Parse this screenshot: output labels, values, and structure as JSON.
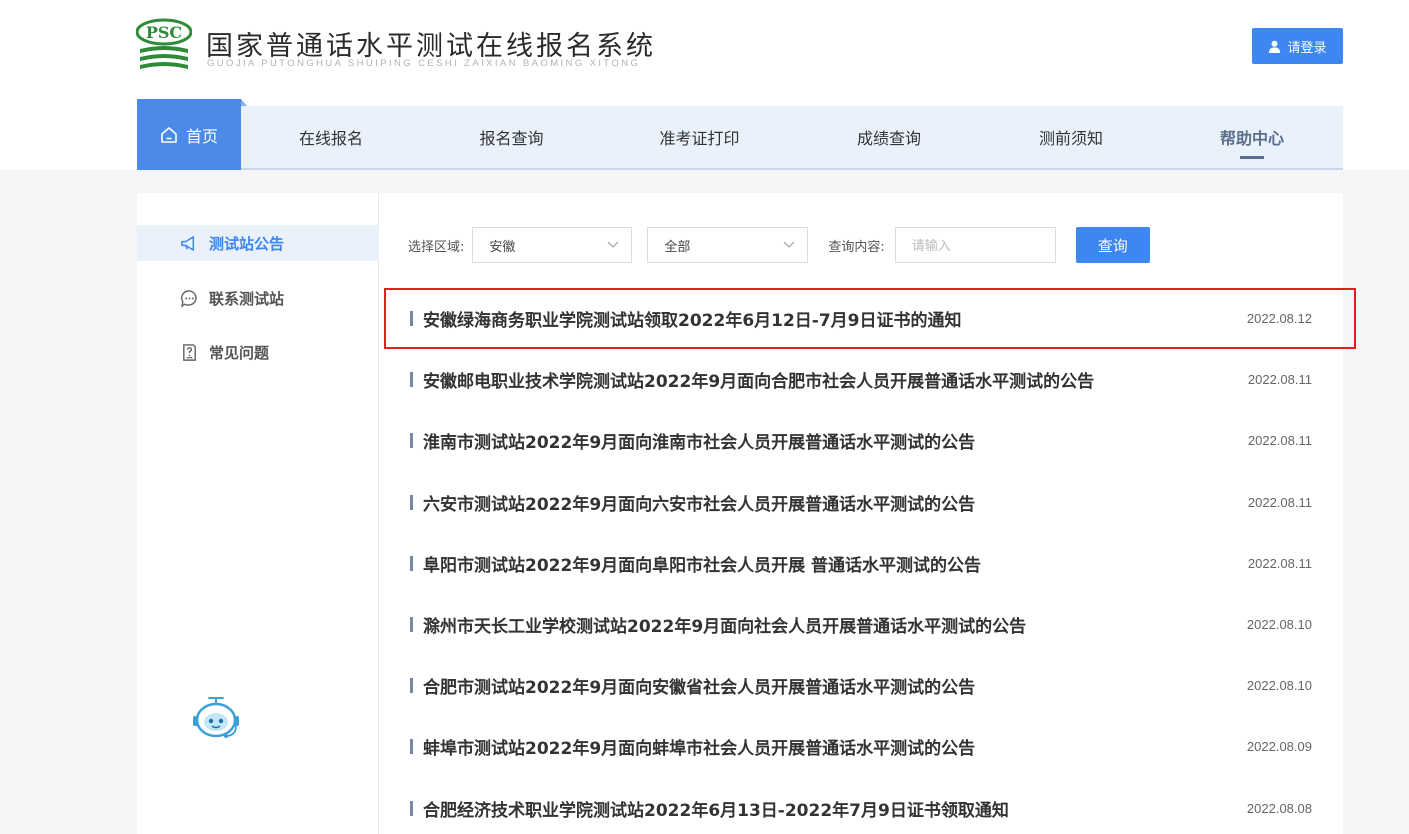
{
  "header": {
    "logo_text": "PSC",
    "title": "国家普通话水平测试在线报名系统",
    "subtitle": "GUOJIA PUTONGHUA SHUIPING CESHI ZAIXIAN BAOMING XITONG",
    "login_label": "请登录"
  },
  "nav": {
    "home_label": "首页",
    "items": [
      {
        "label": "在线报名"
      },
      {
        "label": "报名查询"
      },
      {
        "label": "准考证打印"
      },
      {
        "label": "成绩查询"
      },
      {
        "label": "测前须知"
      },
      {
        "label": "帮助中心",
        "active": true
      }
    ]
  },
  "sidebar": {
    "items": [
      {
        "label": "测试站公告",
        "icon": "megaphone-icon",
        "active": true
      },
      {
        "label": "联系测试站",
        "icon": "chat-icon"
      },
      {
        "label": "常见问题",
        "icon": "document-question-icon"
      }
    ],
    "assistant_icon": "robot-assistant-icon"
  },
  "filters": {
    "region_label": "选择区域:",
    "region_value": "安徽",
    "city_value": "全部",
    "query_label": "查询内容:",
    "query_placeholder": "请输入",
    "query_button": "查询"
  },
  "notices": [
    {
      "title": "安徽绿海商务职业学院测试站领取2022年6月12日-7月9日证书的通知",
      "date": "2022.08.12"
    },
    {
      "title": "安徽邮电职业技术学院测试站2022年9月面向合肥市社会人员开展普通话水平测试的公告",
      "date": "2022.08.11"
    },
    {
      "title": "淮南市测试站2022年9月面向淮南市社会人员开展普通话水平测试的公告",
      "date": "2022.08.11"
    },
    {
      "title": "六安市测试站2022年9月面向六安市社会人员开展普通话水平测试的公告",
      "date": "2022.08.11"
    },
    {
      "title": "阜阳市测试站2022年9月面向阜阳市社会人员开展 普通话水平测试的公告",
      "date": "2022.08.11"
    },
    {
      "title": "滁州市天长工业学校测试站2022年9月面向社会人员开展普通话水平测试的公告",
      "date": "2022.08.10"
    },
    {
      "title": "合肥市测试站2022年9月面向安徽省社会人员开展普通话水平测试的公告",
      "date": "2022.08.10"
    },
    {
      "title": "蚌埠市测试站2022年9月面向蚌埠市社会人员开展普通话水平测试的公告",
      "date": "2022.08.09"
    },
    {
      "title": "合肥经济技术职业学院测试站2022年6月13日-2022年7月9日证书领取通知",
      "date": "2022.08.08"
    }
  ],
  "colors": {
    "accent": "#3e86f0",
    "nav_background": "#e9f1fb",
    "logo_green": "#2e8b3a",
    "highlight_border": "#e02020"
  }
}
